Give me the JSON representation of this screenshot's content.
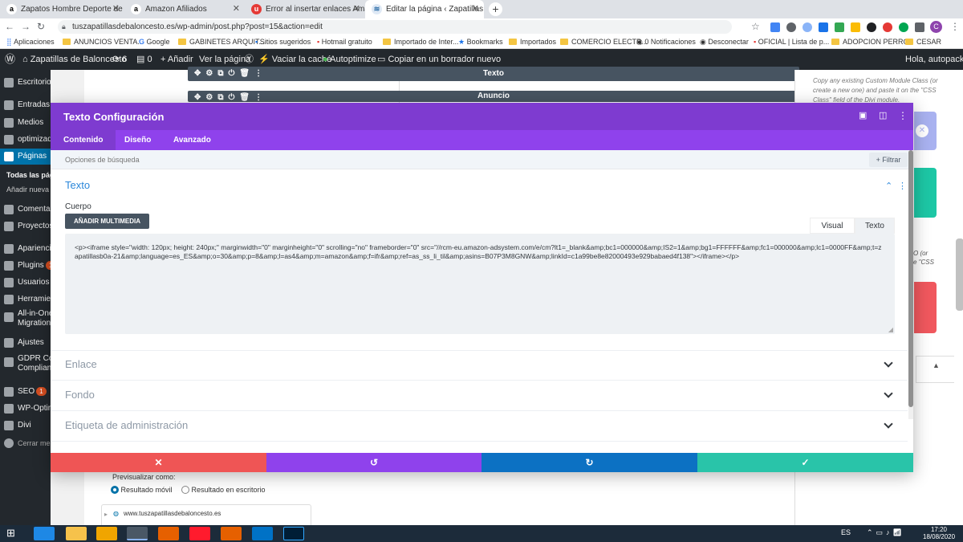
{
  "browser": {
    "tabs": [
      {
        "title": "Zapatos Hombre Deporte de Bal",
        "icon": "a",
        "color": "#f0a500"
      },
      {
        "title": "Amazon Afiliados",
        "icon": "a",
        "color": "#f0a500"
      },
      {
        "title": "Error al insertar enlaces Amazon",
        "icon": "e",
        "color": "#e53935"
      },
      {
        "title": "Editar la página ‹ Zapatillas de B",
        "icon": "w",
        "color": "#2f6fa8"
      }
    ],
    "url": "tuszapatillasdebaloncesto.es/wp-admin/post.php?post=15&action=edit",
    "bookmarks": [
      "Aplicaciones",
      "ANUNCIOS VENTA...",
      "Google",
      "GABINETES ARQUIT...",
      "Sitios sugeridos",
      "Hotmail gratuito",
      "Importado de Inter...",
      "Bookmarks",
      "Importados",
      "COMERCIO ELECTR...",
      "0 Notificaciones",
      "Desconectar",
      "OFICIAL | Lista de p...",
      "ADOPCION PERROS",
      "CESAR"
    ]
  },
  "wpbar": {
    "site": "Zapatillas de Baloncesto",
    "updates": "6",
    "comments": "0",
    "add": "Añadir",
    "view": "Ver la página",
    "cache": "Vaciar la caché",
    "autoptimize": "Autoptimize",
    "copy": "Copiar en un borrador nuevo",
    "greeting": "Hola, autopackswe"
  },
  "sidebar": {
    "items": [
      {
        "label": "Escritorio"
      },
      {
        "label": "Entradas"
      },
      {
        "label": "Medios"
      },
      {
        "label": "optimizad"
      },
      {
        "label": "Páginas"
      },
      {
        "label": "Comentari"
      },
      {
        "label": "Proyectos"
      },
      {
        "label": "Apariencia"
      },
      {
        "label": "Plugins",
        "badge": "1"
      },
      {
        "label": "Usuarios"
      },
      {
        "label": "Herramien"
      },
      {
        "label": "All-in-One"
      },
      {
        "label": "Ajustes"
      },
      {
        "label": "GDPR Coo"
      },
      {
        "label": "SEO",
        "badge": "1"
      },
      {
        "label": "WP-Optim"
      },
      {
        "label": "Divi"
      },
      {
        "label": "Cerrar men"
      }
    ],
    "sub_all": "Todas las págin",
    "sub_new": "Añadir nueva",
    "migration": "Migration",
    "compliance": "Complianc"
  },
  "builder": {
    "module1": "Texto",
    "module2": "Anuncio"
  },
  "right_panel": {
    "hint": "Copy any existing Custom Module Class (or create a new one) and paste it on the \"CSS Class\" field of the Divi module.",
    "frag1": "O (or",
    "frag2": "e \"CSS"
  },
  "modal": {
    "title": "Texto Configuración",
    "tabs": [
      "Contenido",
      "Diseño",
      "Avanzado"
    ],
    "search_placeholder": "Opciones de búsqueda",
    "filter": "Filtrar",
    "section_title": "Texto",
    "body_label": "Cuerpo",
    "media_button": "AÑADIR MULTIMEDIA",
    "editor_tabs": [
      "Visual",
      "Texto"
    ],
    "content": "<p><iframe style=\"width: 120px; height: 240px;\" marginwidth=\"0\" marginheight=\"0\" scrolling=\"no\" frameborder=\"0\" src=\"//rcm-eu.amazon-adsystem.com/e/cm?lt1=_blank&amp;bc1=000000&amp;IS2=1&amp;bg1=FFFFFF&amp;fc1=000000&amp;lc1=0000FF&amp;t=zapatillasb0a-21&amp;language=es_ES&amp;o=30&amp;p=8&amp;l=as4&amp;m=amazon&amp;f=ifr&amp;ref=as_ss_li_til&amp;asins=B07P3M8GNW&amp;linkId=c1a99be8e82000493e929babaed4f138\"></iframe></p>",
    "sections": [
      "Enlace",
      "Fondo",
      "Etiqueta de administración"
    ]
  },
  "preview": {
    "label": "Previsualizar como:",
    "opt_mobile": "Resultado móvil",
    "opt_desktop": "Resultado en escritorio",
    "site": "www.tuszapatillasdebaloncesto.es"
  },
  "taskbar": {
    "lang": "ES",
    "time": "17:20",
    "date": "18/08/2020"
  },
  "colors": {
    "purple": "#7e3bd0",
    "cancel": "#ef5555",
    "undo": "#8f42ec",
    "redo": "#0c71c3",
    "save": "#29c4a9"
  }
}
